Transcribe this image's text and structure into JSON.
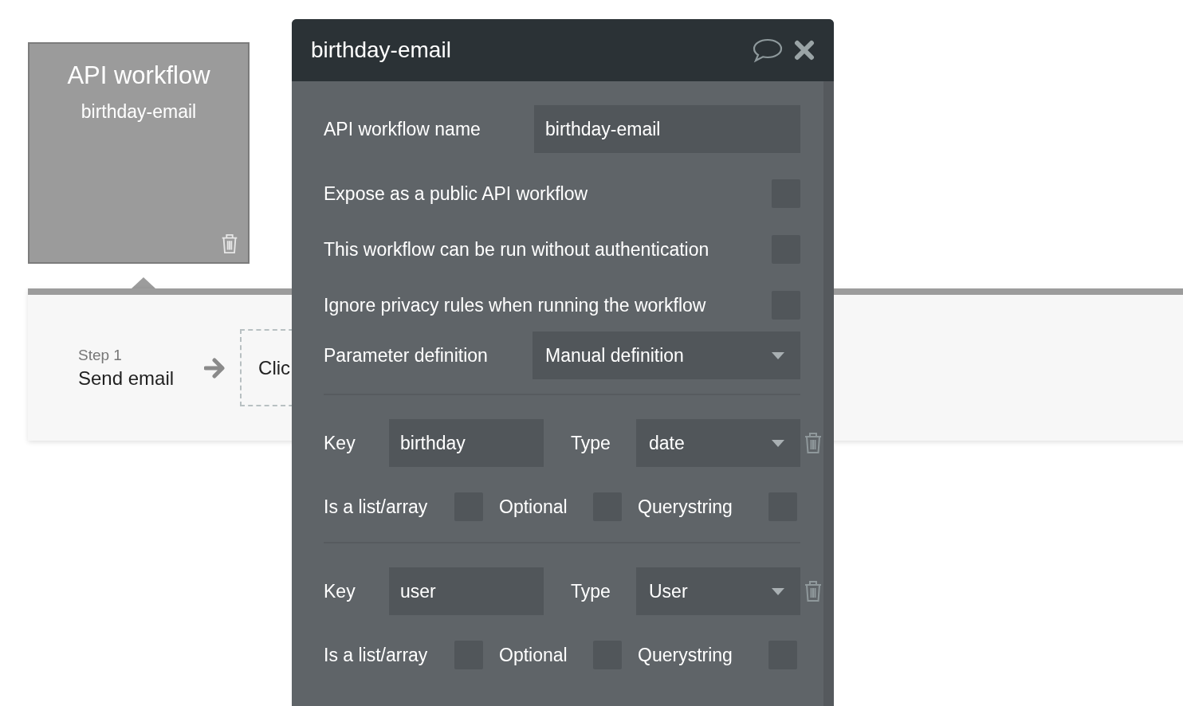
{
  "canvas": {
    "workflow_card": {
      "title": "API workflow",
      "subtitle": "birthday-email"
    },
    "step": {
      "number": "Step 1",
      "action": "Send email"
    },
    "next_step_text": "Clic"
  },
  "dialog": {
    "title": "birthday-email",
    "name_field": {
      "label": "API workflow name",
      "value": "birthday-email"
    },
    "options": [
      {
        "label": "Expose as a public API workflow",
        "checked": false
      },
      {
        "label": "This workflow can be run without authentication",
        "checked": false
      },
      {
        "label": "Ignore privacy rules when running the workflow",
        "checked": false
      }
    ],
    "parameter_definition": {
      "label": "Parameter definition",
      "value": "Manual definition"
    },
    "parameters": [
      {
        "key_label": "Key",
        "key": "birthday",
        "type_label": "Type",
        "type": "date",
        "flags": [
          {
            "label": "Is a list/array",
            "checked": false
          },
          {
            "label": "Optional",
            "checked": false
          },
          {
            "label": "Querystring",
            "checked": false
          }
        ]
      },
      {
        "key_label": "Key",
        "key": "user",
        "type_label": "Type",
        "type": "User",
        "flags": [
          {
            "label": "Is a list/array",
            "checked": false
          },
          {
            "label": "Optional",
            "checked": false
          },
          {
            "label": "Querystring",
            "checked": false
          }
        ]
      }
    ]
  }
}
